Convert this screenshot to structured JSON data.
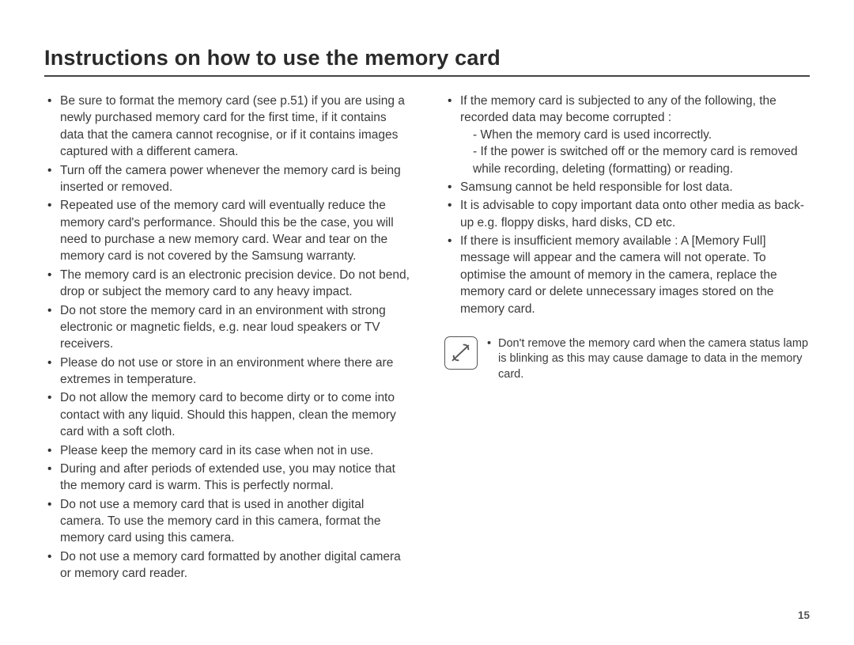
{
  "title": "Instructions on how to use the memory card",
  "page_number": "15",
  "left_bullets": [
    "Be sure to format the memory card (see p.51) if you are using a newly purchased memory card for the first time, if it contains data that the camera cannot recognise, or if it contains images captured with a different camera.",
    "Turn off the camera power whenever the memory card is being inserted or removed.",
    "Repeated use of the memory card will eventually reduce the memory card's performance. Should this be the case, you will need to purchase a new memory card. Wear and tear on the memory card is not covered by the Samsung warranty.",
    "The memory card is an electronic precision device. Do not bend, drop or subject the memory card to any heavy impact.",
    "Do not store the memory card in an environment with strong electronic or magnetic fields, e.g. near loud speakers or TV receivers.",
    "Please do not use or store in an environment where there are extremes in temperature.",
    "Do not allow the memory card to become dirty or to come into contact with any liquid. Should this happen, clean the memory card with a soft cloth.",
    "Please keep the memory card in its case when not in use.",
    "During and after periods of extended use, you may notice that the memory card is warm. This is perfectly normal.",
    "Do not use a memory card that is used in another digital camera. To use the memory card in this camera, format the memory card using this camera.",
    "Do not use a memory card formatted by another digital camera or memory card reader."
  ],
  "right_bullets_1": {
    "lead": "If the memory card is subjected to any of the following, the recorded data may become corrupted :",
    "subs": [
      "- When the memory card is used incorrectly.",
      "- If the power is switched off or the memory card is removed while recording, deleting (formatting) or reading."
    ]
  },
  "right_bullets_rest": [
    "Samsung cannot be held responsible for lost data.",
    "It is advisable to copy important data onto other media as back-up e.g. floppy disks, hard disks, CD etc.",
    "If there is insufficient memory available : A [Memory Full] message will appear and the camera will not operate. To optimise the amount of memory in the camera, replace the memory card or delete unnecessary images stored on the memory card."
  ],
  "note": "Don't remove the memory card when the camera status lamp is blinking as this may cause damage to data in the memory card."
}
